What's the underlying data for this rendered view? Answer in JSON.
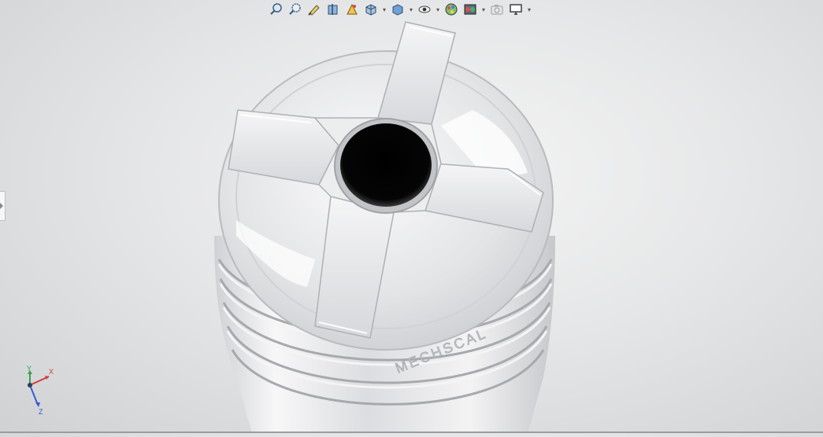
{
  "viewport": {
    "model_text": "MECHSCAL",
    "triad_labels": {
      "x": "X",
      "y": "Y",
      "z": "Z"
    }
  },
  "toolbar": {
    "buttons": [
      {
        "name": "zoom-to-fit-icon",
        "dropdown": false
      },
      {
        "name": "zoom-to-area-icon",
        "dropdown": false
      },
      {
        "name": "previous-view-icon",
        "dropdown": false
      },
      {
        "name": "section-view-icon",
        "dropdown": false
      },
      {
        "name": "dynamic-annotation-views-icon",
        "dropdown": false
      },
      {
        "name": "view-orientation-icon",
        "dropdown": true
      },
      {
        "name": "display-style-icon",
        "dropdown": true
      },
      {
        "name": "hide-show-items-icon",
        "dropdown": true
      },
      {
        "name": "edit-appearance-icon",
        "dropdown": false
      },
      {
        "name": "apply-scene-icon",
        "dropdown": true
      },
      {
        "name": "view-settings-icon",
        "dropdown": false
      },
      {
        "name": "screen-display-icon",
        "dropdown": true
      }
    ]
  }
}
